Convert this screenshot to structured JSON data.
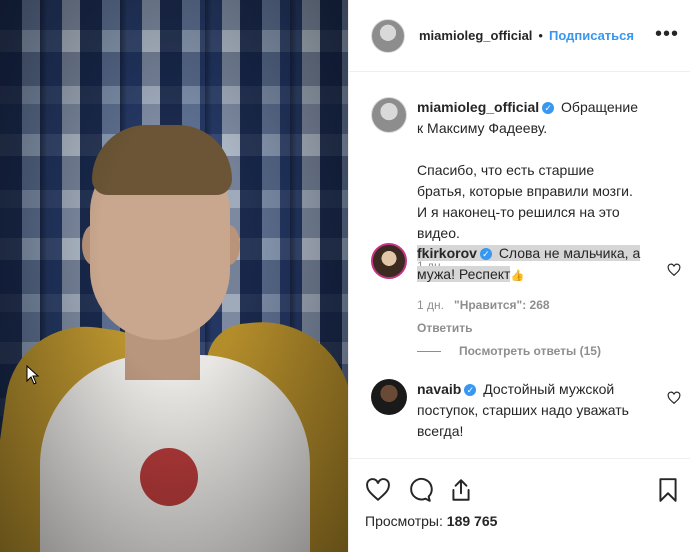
{
  "post": {
    "username": "miamioleg_official",
    "separator": "•",
    "follow_label": "Подписаться",
    "more_label": "•••"
  },
  "caption": {
    "username": "miamioleg_official",
    "line1": "Обращение к Максиму Фадееву.",
    "line2": "Спасибо, что есть старшие братья, которые вправили мозги. И я наконец-то решился на это видео.",
    "time": "1 дн."
  },
  "comments": [
    {
      "username": "fkirkorov",
      "text": "Слова не мальчика, а мужа! Респект",
      "emoji": "👍",
      "time": "1 дн.",
      "likes": "\"Нравится\": 268",
      "reply": "Ответить",
      "view_replies": "Посмотреть ответы (15)"
    },
    {
      "username": "navaib",
      "text": "Достойный мужской поступок, старших надо уважать всегда!"
    }
  ],
  "footer": {
    "views_label": "Просмотры:",
    "views_count": "189 765"
  },
  "icons": {
    "heart": "heart-icon",
    "comment": "comment-icon",
    "share": "share-icon",
    "bookmark": "bookmark-icon",
    "verified": "verified-badge-icon"
  },
  "colors": {
    "accent": "#3897f0",
    "text": "#262626",
    "muted": "#8e8e8e"
  }
}
